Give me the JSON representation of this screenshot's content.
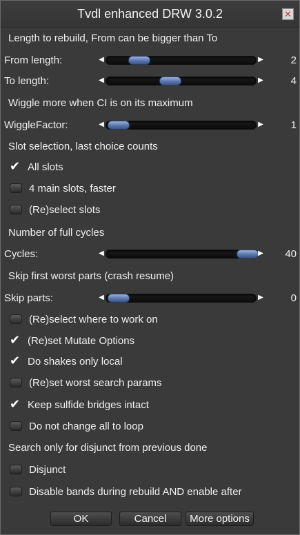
{
  "window": {
    "title": "Tvdl enhanced DRW 3.0.2"
  },
  "sections": {
    "length": "Length to rebuild, From can be bigger than To",
    "wiggle": "Wiggle more when CI is on its maximum",
    "slots": "Slot selection, last choice counts",
    "cycles": "Number of full cycles",
    "skip": "Skip first worst parts (crash resume)",
    "disjunct": "Search only for disjunct from previous done"
  },
  "sliders": {
    "from": {
      "label": "From length:",
      "value": "2",
      "fraction": 0.16
    },
    "to": {
      "label": "To length:",
      "value": "4",
      "fraction": 0.4
    },
    "wiggle": {
      "label": "WiggleFactor:",
      "value": "1",
      "fraction": 0.0
    },
    "cycles": {
      "label": "Cycles:",
      "value": "40",
      "fraction": 1.0
    },
    "skip": {
      "label": "Skip parts:",
      "value": "0",
      "fraction": 0.0
    }
  },
  "slot_options": [
    {
      "label": "All slots",
      "checked": true
    },
    {
      "label": "4 main slots, faster",
      "checked": false
    },
    {
      "label": "(Re)select slots",
      "checked": false
    }
  ],
  "work_options": [
    {
      "label": "(Re)select where to work on",
      "checked": false
    },
    {
      "label": "(Re)set Mutate Options",
      "checked": true
    },
    {
      "label": "Do shakes only local",
      "checked": true
    },
    {
      "label": "(Re)set worst search params",
      "checked": false
    },
    {
      "label": "Keep sulfide bridges intact",
      "checked": true
    },
    {
      "label": "Do not change all to loop",
      "checked": false
    }
  ],
  "disjunct_options": [
    {
      "label": "Disjunct",
      "checked": false
    },
    {
      "label": "Disable bands during rebuild AND enable after",
      "checked": false
    }
  ],
  "buttons": {
    "ok": "OK",
    "cancel": "Cancel",
    "more": "More options"
  },
  "icons": {
    "close": "close-icon",
    "check": "check-mark-icon",
    "left": "arrow-left-icon",
    "right": "arrow-right-icon"
  },
  "colors": {
    "background": "#3a3a3a",
    "thumb": "#6c89c0",
    "close": "#d8343a"
  }
}
